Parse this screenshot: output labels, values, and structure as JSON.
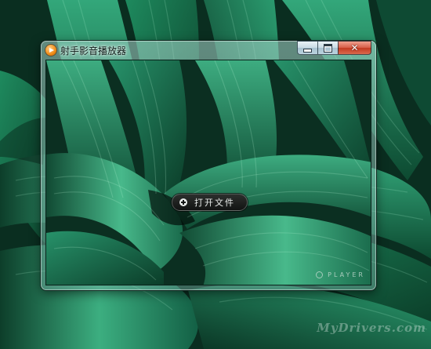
{
  "window": {
    "title": "射手影音播放器",
    "buttons": {
      "close_symbol": "✕"
    }
  },
  "player": {
    "open_file_label": "打开文件",
    "logo_text": "PLAYER"
  },
  "watermark": "MyDrivers.com",
  "icons": [
    "app-player-icon",
    "minimize-icon",
    "maximize-icon",
    "close-icon",
    "plus-circle-icon",
    "player-logo-icon"
  ],
  "colors": {
    "wallpaper": "#0f5a3c",
    "leaf_highlight": "#3aa57a",
    "close_button": "#c33a20",
    "app_icon": "#f08a14"
  }
}
